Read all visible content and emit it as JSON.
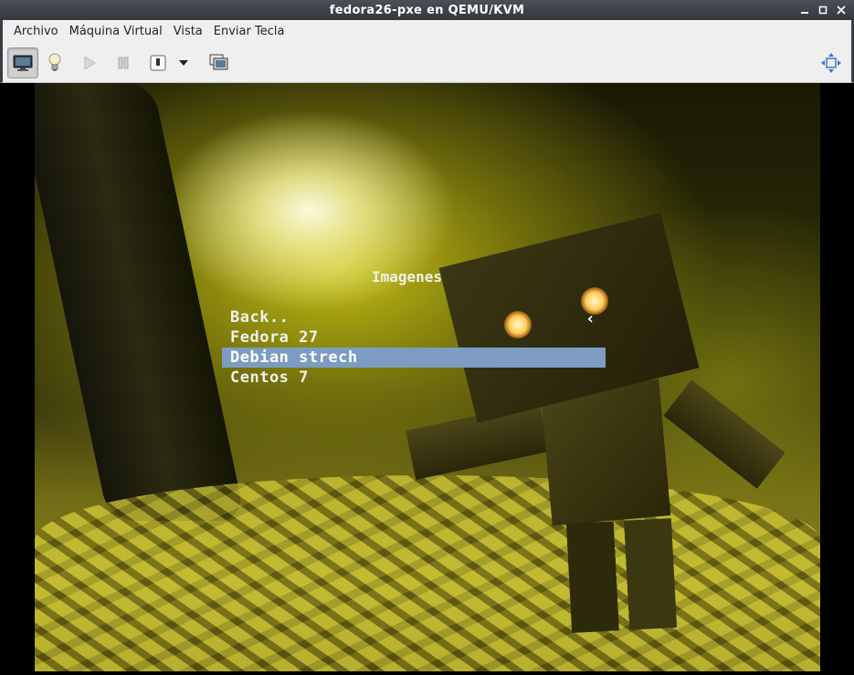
{
  "window": {
    "title": "fedora26-pxe en QEMU/KVM",
    "controls": [
      "minimize",
      "maximize",
      "close"
    ]
  },
  "menubar": {
    "items": [
      "Archivo",
      "Máquina Virtual",
      "Vista",
      "Enviar Tecla"
    ]
  },
  "toolbar": {
    "buttons": [
      {
        "name": "console-view",
        "icon": "monitor-icon",
        "active": true
      },
      {
        "name": "details-view",
        "icon": "lightbulb-icon",
        "active": false
      },
      {
        "name": "run",
        "icon": "play-icon",
        "active": false
      },
      {
        "name": "pause",
        "icon": "pause-icon",
        "active": false
      },
      {
        "name": "shutdown",
        "icon": "power-icon",
        "active": false
      },
      {
        "name": "shutdown-menu",
        "icon": "chevron-down-icon",
        "active": false
      },
      {
        "name": "snapshots",
        "icon": "snapshot-icon",
        "active": false
      },
      {
        "name": "fullscreen",
        "icon": "fullscreen-arrows-icon",
        "active": false
      }
    ]
  },
  "boot_menu": {
    "title": "Imagenes",
    "items": [
      "Back..",
      "Fedora 27",
      "Debian strech",
      "Centos 7"
    ],
    "selected_index": 2,
    "selection_color": "#7c9cc3"
  },
  "colors": {
    "titlebar": "#3a3e44",
    "chrome": "#efefef"
  }
}
